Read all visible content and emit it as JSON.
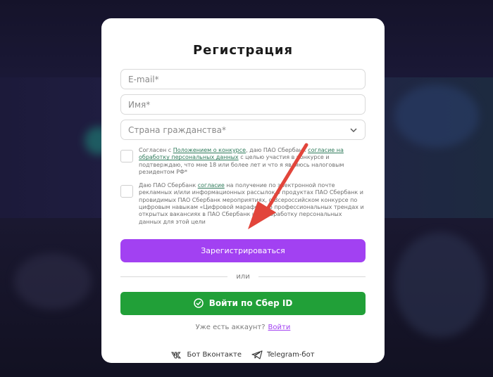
{
  "modal": {
    "title": "Регистрация",
    "email_placeholder": "E-mail*",
    "name_placeholder": "Имя*",
    "country_placeholder": "Страна гражданства*",
    "consent1": {
      "t1": "Согласен с ",
      "link1": "Положением о конкурсе",
      "t2": ", даю ПАО Сбербанк ",
      "link2": "согласие на обработку персональных данных",
      "t3": " с целью участия в конкурсе и подтверждаю, что мне 18 или более лет и что я являюсь налоговым резидентом РФ*"
    },
    "consent2": {
      "t1": "Даю ПАО Сбербанк ",
      "link1": "согласие",
      "t2": " на получение по электронной почте рекламных и/или информационных рассылок о продуктах ПАО Сбербанк и провидимых ПАО Сбербанк мероприятиях, о Всероссийском конкурсе по цифровым навыкам «Цифровой марафон», о профессиональных трендах и открытых вакансиях в ПАО Сбербанк и на обработку персональных данных для этой цели"
    },
    "register_button": "Зарегистрироваться",
    "or_text": "или",
    "sber_button": "Войти по Сбер ID",
    "have_account": "Уже есть аккаунт?",
    "login_link": "Войти",
    "vk_bot": "Бот Вконтакте",
    "tg_bot": "Telegram-бот"
  },
  "colors": {
    "accent_purple": "#a241f2",
    "sber_green": "#21a038",
    "arrow_red": "#e2453b"
  },
  "icons": [
    "chevron-down-icon",
    "check-circle-icon",
    "vk-icon",
    "telegram-icon",
    "arrow-annotation-icon"
  ]
}
